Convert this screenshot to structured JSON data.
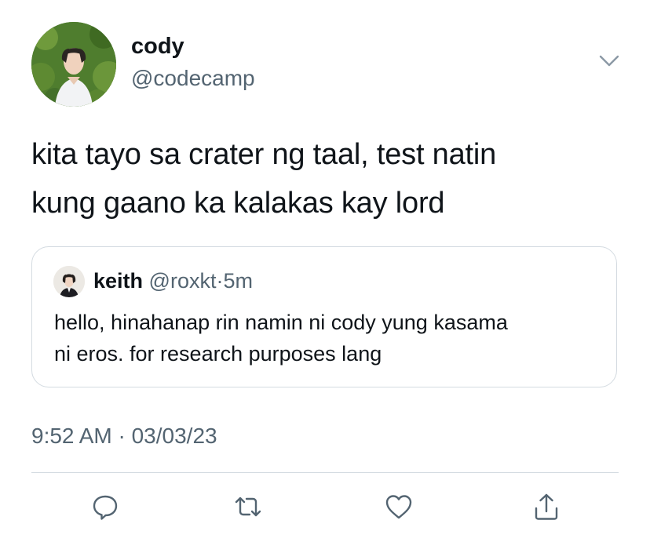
{
  "tweet": {
    "display_name": "cody",
    "handle": "@codecamp",
    "text_lines": [
      "kita tayo sa crater ng taal, test natin",
      "kung gaano ka kalakas kay lord"
    ],
    "timestamp": "9:52 AM · 03/03/23"
  },
  "quote": {
    "display_name": "keith",
    "handle": "@roxkt",
    "separator": "·",
    "time": "5m",
    "text_lines": [
      "hello, hinahanap rin namin ni cody yung kasama",
      "ni eros. for research purposes lang"
    ]
  },
  "icons": {
    "more": "chevron-down-icon",
    "reply": "reply-icon",
    "retweet": "retweet-icon",
    "like": "heart-icon",
    "share": "share-icon"
  },
  "colors": {
    "text": "#0f1419",
    "secondary": "#536471",
    "border": "#d4dbe1"
  }
}
